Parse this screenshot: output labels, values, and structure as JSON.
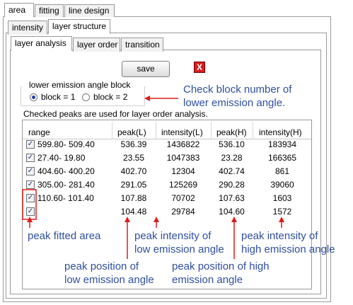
{
  "top_tabs": [
    "area",
    "fitting",
    "line design"
  ],
  "second_tabs": [
    "intensity",
    "layer structure"
  ],
  "inner_tabs": [
    "layer analysis",
    "layer order",
    "transition"
  ],
  "save_label": "save",
  "close_label": "X",
  "group": {
    "title": "lower emission angle block",
    "options": [
      "block = 1",
      "block = 2"
    ],
    "selected": "block = 1"
  },
  "caption": "Checked peaks are used for layer order analysis.",
  "table": {
    "columns": [
      "range",
      "peak(L)",
      "intensity(L)",
      "peak(H)",
      "intensity(H)"
    ],
    "rows": [
      {
        "checked": true,
        "cells": [
          "599.80- 509.40",
          "536.39",
          "1436822",
          "536.10",
          "183934"
        ]
      },
      {
        "checked": true,
        "cells": [
          "27.40- 19.80",
          "23.55",
          "1047383",
          "23.28",
          "166365"
        ]
      },
      {
        "checked": true,
        "cells": [
          "404.60- 400.20",
          "402.70",
          "12304",
          "402.74",
          "861"
        ]
      },
      {
        "checked": true,
        "cells": [
          "305.00- 281.40",
          "291.05",
          "125269",
          "290.28",
          "39060"
        ]
      },
      {
        "checked": true,
        "cells": [
          "110.60- 101.40",
          "107.88",
          "70702",
          "107.63",
          "1603"
        ]
      },
      {
        "checked": true,
        "cells": [
          "",
          "104.48",
          "29784",
          "104.60",
          "1572"
        ]
      }
    ]
  },
  "annotations": {
    "block_note": [
      "Check block number of",
      "lower emission angle."
    ],
    "peak_fitted_area": "peak fitted area",
    "peak_intensity_low": [
      "peak intensity of",
      "low emission angle"
    ],
    "peak_intensity_high": [
      "peak intensity of",
      "high emission angle"
    ],
    "peak_position_low": [
      "peak position of",
      "low emission angle"
    ],
    "peak_position_high": [
      "peak position of high",
      "emission angle"
    ]
  },
  "colors": {
    "annotation_text": "#2f4f9f",
    "arrow": "#e01b1b",
    "close_button": "#d81d1d"
  }
}
